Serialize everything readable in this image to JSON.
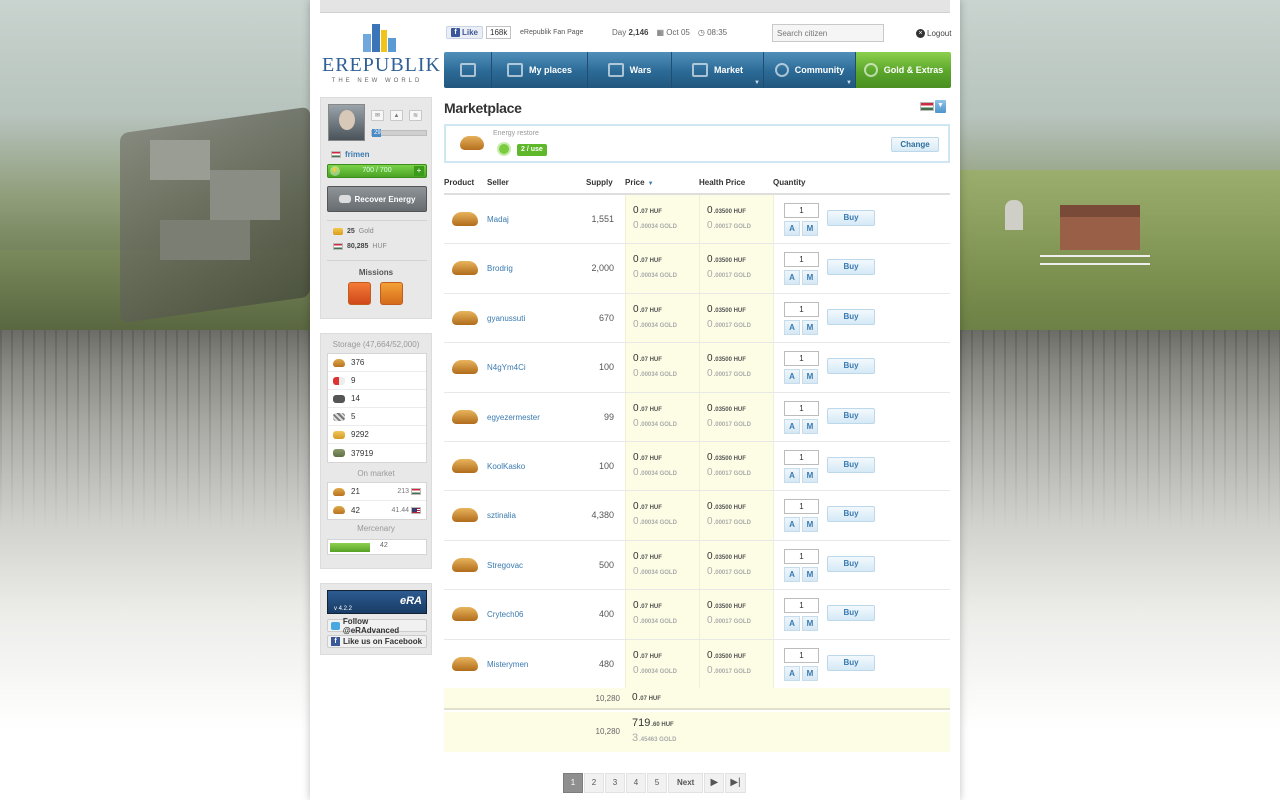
{
  "header": {
    "logo_text": "EREPUBLIK",
    "logo_sub": "THE NEW WORLD",
    "fb_like_label": "Like",
    "fb_like_count": "168k",
    "fan_page": "eRepublik Fan Page",
    "day_label": "Day",
    "day_number": "2,146",
    "date": "Oct 05",
    "time": "08:35",
    "search_placeholder": "Search citizen",
    "logout_label": "Logout"
  },
  "nav": {
    "items": [
      {
        "label": "",
        "icon": "home-icon"
      },
      {
        "label": "My places",
        "icon": "flag-icon"
      },
      {
        "label": "Wars",
        "icon": "tank-icon"
      },
      {
        "label": "Market",
        "icon": "bag-icon"
      },
      {
        "label": "Community",
        "icon": "people-icon"
      },
      {
        "label": "Gold & Extras",
        "icon": "gold-icon"
      }
    ]
  },
  "sidebar": {
    "level": "29",
    "username": "frimen",
    "energy_text": "700 / 700",
    "recover_label": "Recover Energy",
    "gold_amount": "25",
    "gold_label": "Gold",
    "huf_amount": "80,285",
    "huf_label": "HUF",
    "missions_title": "Missions",
    "storage_title": "Storage (47,664/52,000)",
    "storage": [
      {
        "icon": "bread-icon",
        "qty": "376"
      },
      {
        "icon": "weapon-icon",
        "qty": "9"
      },
      {
        "icon": "tank-icon",
        "qty": "14"
      },
      {
        "icon": "rifle-icon",
        "qty": "5"
      },
      {
        "icon": "grain-icon",
        "qty": "9292"
      },
      {
        "icon": "raw-material-icon",
        "qty": "37919"
      }
    ],
    "on_market_title": "On market",
    "on_market": [
      {
        "qty": "21",
        "price": "213",
        "flag": "hungary"
      },
      {
        "qty": "42",
        "price": "41.44",
        "flag": "usa"
      }
    ],
    "mercenary_title": "Mercenary",
    "mercenary_value": "42",
    "mercenary_progress": 0.42,
    "era_version": "v 4.2.2",
    "era_logo": "eRA",
    "follow_label": "Follow @eRAdvanced",
    "like_fb_label": "Like us on Facebook"
  },
  "main": {
    "title": "Marketplace",
    "product": {
      "label": "Energy restore",
      "use_badge": "2 / use",
      "change_label": "Change"
    },
    "columns": {
      "product": "Product",
      "seller": "Seller",
      "supply": "Supply",
      "price": "Price",
      "health_price": "Health Price",
      "quantity": "Quantity"
    },
    "currency_huf": "HUF",
    "currency_gold": "GOLD",
    "a_label": "A",
    "m_label": "M",
    "buy_label": "Buy",
    "rows": [
      {
        "seller": "Madaj",
        "supply": "1,551",
        "price_int": "0",
        "price_dec": ".07",
        "gold_int": "0",
        "gold_dec": ".00034",
        "hp_int": "0",
        "hp_dec": ".03500",
        "hp_gold_int": "0",
        "hp_gold_dec": ".00017",
        "qty": "1"
      },
      {
        "seller": "Brodrig",
        "supply": "2,000",
        "price_int": "0",
        "price_dec": ".07",
        "gold_int": "0",
        "gold_dec": ".00034",
        "hp_int": "0",
        "hp_dec": ".03500",
        "hp_gold_int": "0",
        "hp_gold_dec": ".00017",
        "qty": "1"
      },
      {
        "seller": "gyanussuti",
        "supply": "670",
        "price_int": "0",
        "price_dec": ".07",
        "gold_int": "0",
        "gold_dec": ".00034",
        "hp_int": "0",
        "hp_dec": ".03500",
        "hp_gold_int": "0",
        "hp_gold_dec": ".00017",
        "qty": "1"
      },
      {
        "seller": "N4gYm4Ci",
        "supply": "100",
        "price_int": "0",
        "price_dec": ".07",
        "gold_int": "0",
        "gold_dec": ".00034",
        "hp_int": "0",
        "hp_dec": ".03500",
        "hp_gold_int": "0",
        "hp_gold_dec": ".00017",
        "qty": "1"
      },
      {
        "seller": "egyezermester",
        "supply": "99",
        "price_int": "0",
        "price_dec": ".07",
        "gold_int": "0",
        "gold_dec": ".00034",
        "hp_int": "0",
        "hp_dec": ".03500",
        "hp_gold_int": "0",
        "hp_gold_dec": ".00017",
        "qty": "1"
      },
      {
        "seller": "KoolKasko",
        "supply": "100",
        "price_int": "0",
        "price_dec": ".07",
        "gold_int": "0",
        "gold_dec": ".00034",
        "hp_int": "0",
        "hp_dec": ".03500",
        "hp_gold_int": "0",
        "hp_gold_dec": ".00017",
        "qty": "1"
      },
      {
        "seller": "sztinalia",
        "supply": "4,380",
        "price_int": "0",
        "price_dec": ".07",
        "gold_int": "0",
        "gold_dec": ".00034",
        "hp_int": "0",
        "hp_dec": ".03500",
        "hp_gold_int": "0",
        "hp_gold_dec": ".00017",
        "qty": "1"
      },
      {
        "seller": "Stregovac",
        "supply": "500",
        "price_int": "0",
        "price_dec": ".07",
        "gold_int": "0",
        "gold_dec": ".00034",
        "hp_int": "0",
        "hp_dec": ".03500",
        "hp_gold_int": "0",
        "hp_gold_dec": ".00017",
        "qty": "1"
      },
      {
        "seller": "Crytech06",
        "supply": "400",
        "price_int": "0",
        "price_dec": ".07",
        "gold_int": "0",
        "gold_dec": ".00034",
        "hp_int": "0",
        "hp_dec": ".03500",
        "hp_gold_int": "0",
        "hp_gold_dec": ".00017",
        "qty": "1"
      },
      {
        "seller": "Misterymen",
        "supply": "480",
        "price_int": "0",
        "price_dec": ".07",
        "gold_int": "0",
        "gold_dec": ".00034",
        "hp_int": "0",
        "hp_dec": ".03500",
        "hp_gold_int": "0",
        "hp_gold_dec": ".00017",
        "qty": "1"
      }
    ],
    "total1": {
      "supply": "10,280",
      "price_int": "0",
      "price_dec": ".07"
    },
    "total2": {
      "supply": "10,280",
      "price_int": "719",
      "price_dec": ".60",
      "gold_int": "3",
      "gold_dec": ".45463"
    }
  },
  "pager": {
    "pages": [
      "1",
      "2",
      "3",
      "4",
      "5"
    ],
    "active": "1",
    "next_label": "Next"
  }
}
